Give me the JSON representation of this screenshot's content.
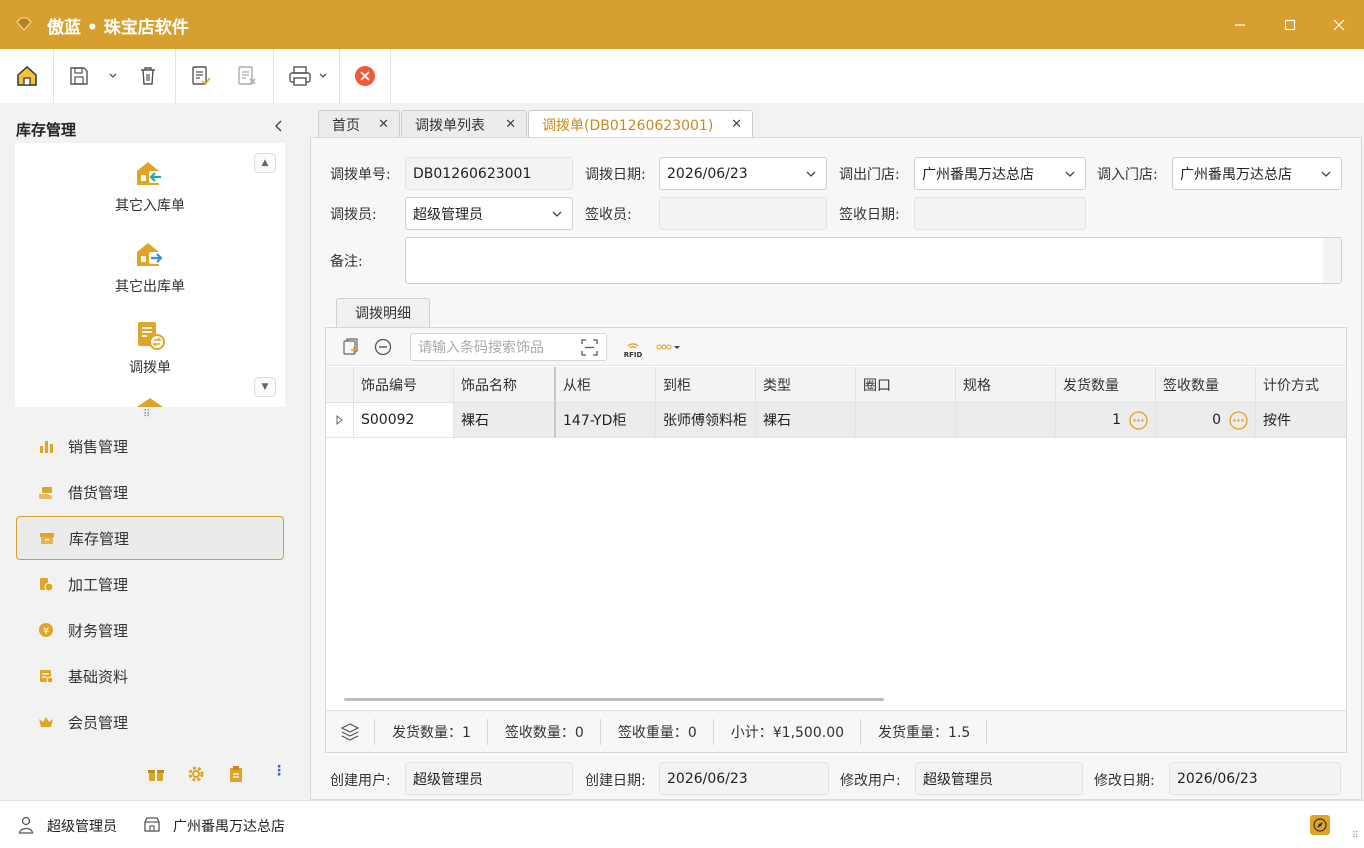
{
  "app": {
    "title": "傲蓝 • 珠宝店软件",
    "accent": "#d79f2e"
  },
  "sidebar": {
    "title": "库存管理",
    "quick_items": [
      {
        "label": "其它入库单",
        "icon": "warehouse-in-icon"
      },
      {
        "label": "其它出库单",
        "icon": "warehouse-out-icon"
      },
      {
        "label": "调拨单",
        "icon": "transfer-doc-icon"
      }
    ],
    "nav": [
      {
        "label": "销售管理",
        "icon": "bar-chart-icon"
      },
      {
        "label": "借货管理",
        "icon": "handover-icon"
      },
      {
        "label": "库存管理",
        "icon": "inventory-box-icon"
      },
      {
        "label": "加工管理",
        "icon": "processing-icon"
      },
      {
        "label": "财务管理",
        "icon": "currency-icon"
      },
      {
        "label": "基础资料",
        "icon": "basic-data-icon"
      },
      {
        "label": "会员管理",
        "icon": "crown-icon"
      }
    ]
  },
  "tabs": [
    {
      "label": "首页"
    },
    {
      "label": "调拨单列表"
    },
    {
      "label": "调拨单(DB01260623001)"
    }
  ],
  "form": {
    "no_label": "调拨单号:",
    "no_value": "DB01260623001",
    "date_label": "调拨日期:",
    "date_value": "2026/06/23",
    "out_store_label": "调出门店:",
    "out_store_value": "广州番禺万达总店",
    "in_store_label": "调入门店:",
    "in_store_value": "广州番禺万达总店",
    "operator_label": "调拨员:",
    "operator_value": "超级管理员",
    "receiver_label": "签收员:",
    "receiver_value": "",
    "receive_date_label": "签收日期:",
    "receive_date_value": "",
    "remark_label": "备注:",
    "remark_value": ""
  },
  "detail": {
    "tab_label": "调拨明细",
    "search_placeholder": "请输入条码搜索饰品",
    "rfid_label": "RFID",
    "columns": [
      "饰品编号",
      "饰品名称",
      "从柜",
      "到柜",
      "类型",
      "圈口",
      "规格",
      "发货数量",
      "签收数量",
      "计价方式"
    ],
    "rows": [
      {
        "code": "S00092",
        "name": "裸石",
        "from": "147-YD柜",
        "to": "张师傅领料柜",
        "type": "裸石",
        "ring": "",
        "spec": "",
        "ship_qty": "1",
        "recv_qty": "0",
        "pricing": "按件"
      }
    ],
    "summary": [
      "发货数量：1",
      "签收数量：0",
      "签收重量：0",
      "小计：¥1,500.00",
      "发货重量：1.5"
    ]
  },
  "footer": {
    "creator_label": "创建用户:",
    "creator_value": "超级管理员",
    "created_label": "创建日期:",
    "created_value": "2026/06/23",
    "modifier_label": "修改用户:",
    "modifier_value": "超级管理员",
    "modified_label": "修改日期:",
    "modified_value": "2026/06/23"
  },
  "status": {
    "user": "超级管理员",
    "store": "广州番禺万达总店"
  }
}
